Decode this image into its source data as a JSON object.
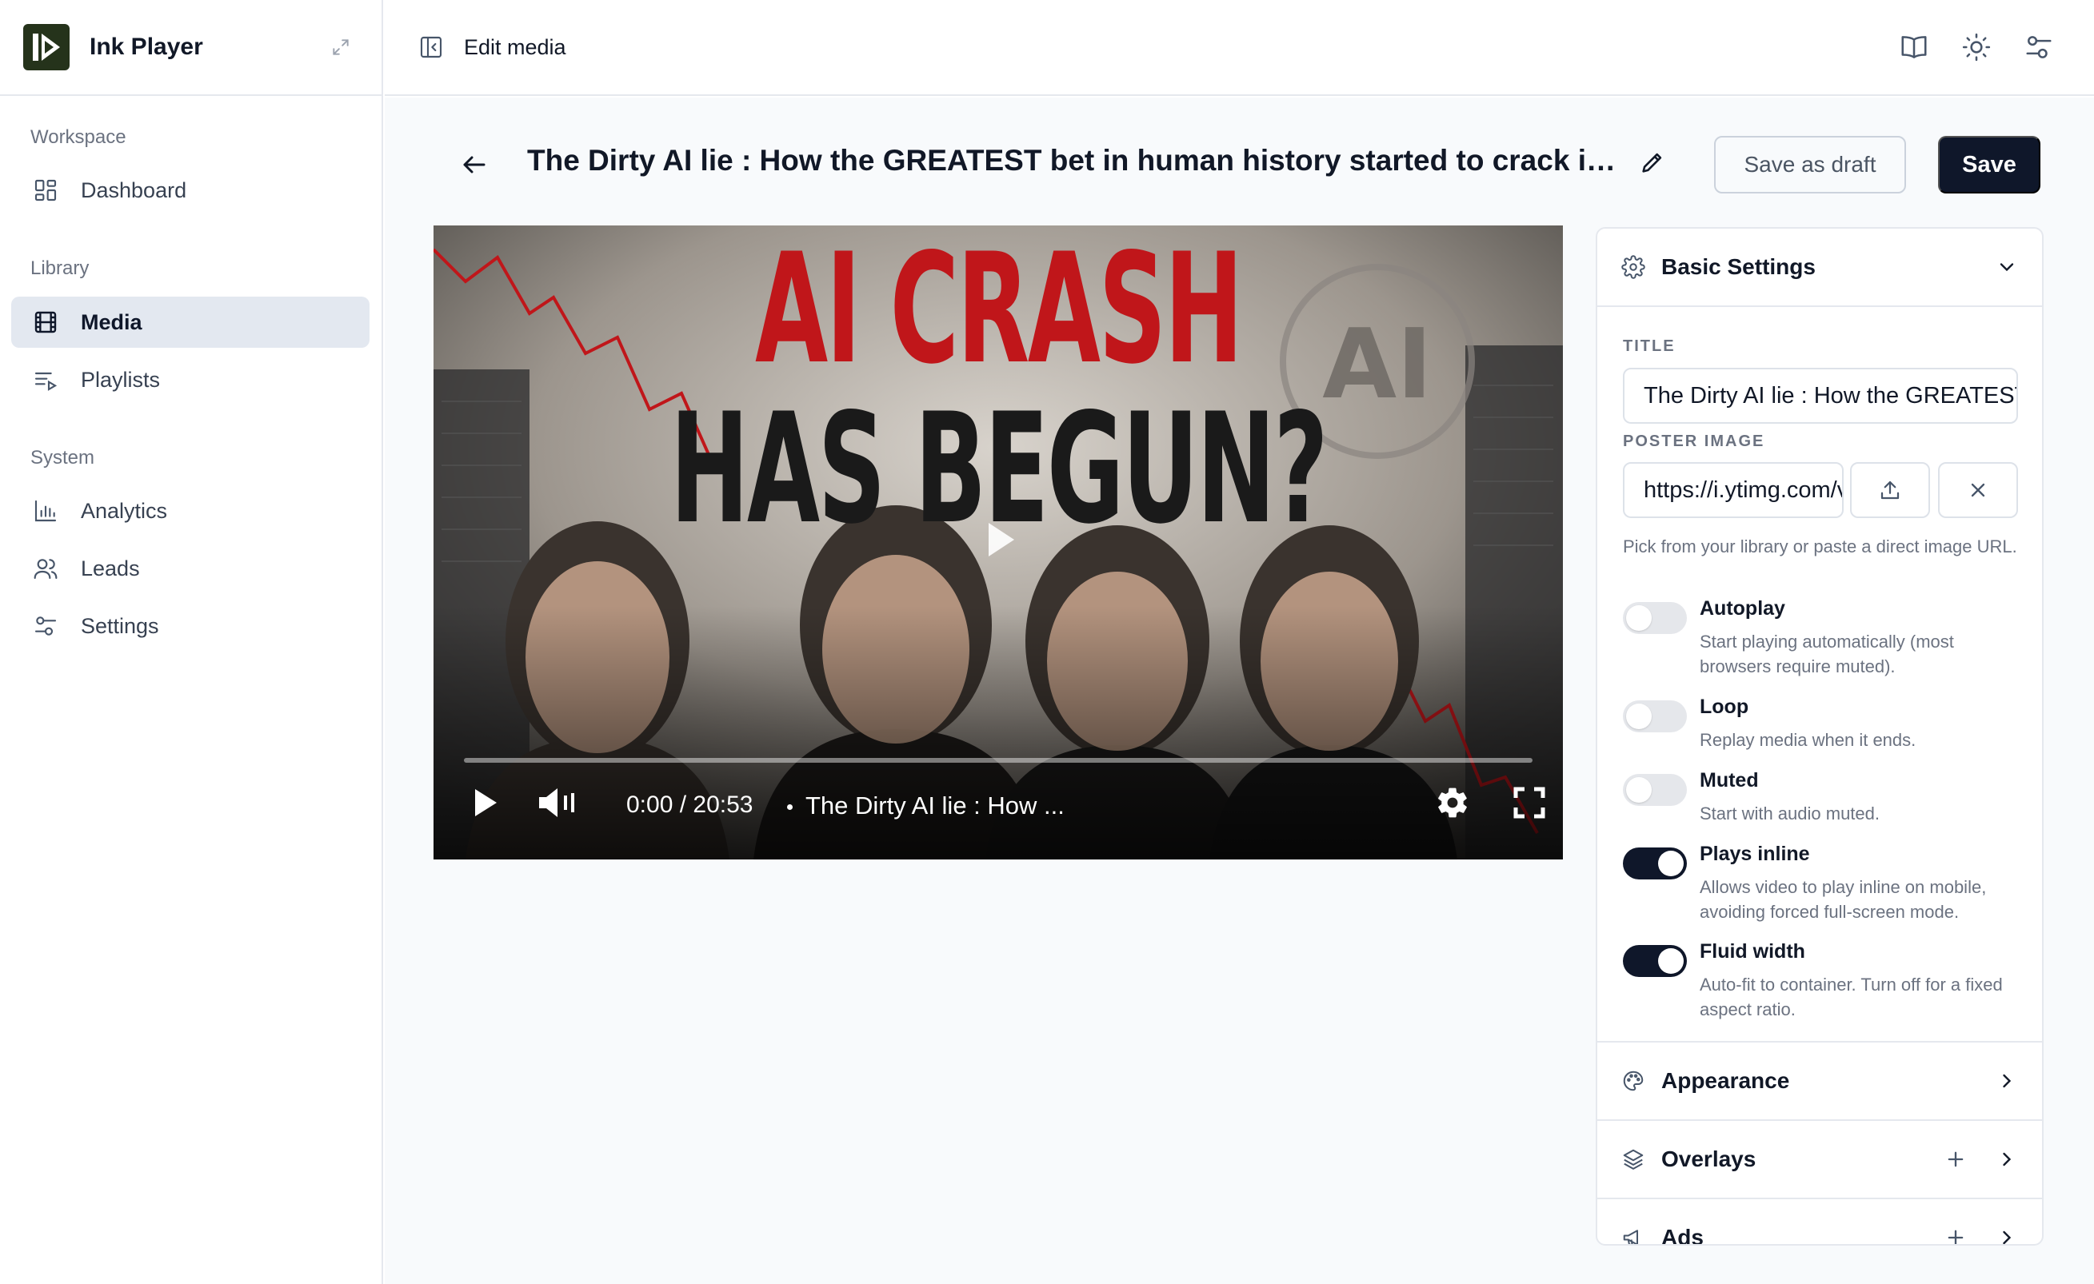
{
  "app": {
    "name": "Ink Player"
  },
  "sidebar": {
    "sections": [
      {
        "title": "Workspace",
        "items": [
          {
            "label": "Dashboard",
            "icon": "dashboard-icon"
          }
        ]
      },
      {
        "title": "Library",
        "items": [
          {
            "label": "Media",
            "icon": "film-icon",
            "active": true
          },
          {
            "label": "Playlists",
            "icon": "playlist-icon"
          }
        ]
      },
      {
        "title": "System",
        "items": [
          {
            "label": "Analytics",
            "icon": "bar-chart-icon"
          },
          {
            "label": "Leads",
            "icon": "users-icon"
          },
          {
            "label": "Settings",
            "icon": "settings-sliders-icon"
          }
        ]
      }
    ]
  },
  "header": {
    "page_title": "Edit media",
    "icons": [
      "book-icon",
      "sun-icon",
      "sliders-icon"
    ]
  },
  "editor": {
    "title": "The Dirty AI lie : How the GREATEST bet in human history started to crack in Ju...",
    "save_draft_label": "Save as draft",
    "save_label": "Save"
  },
  "player": {
    "thumbnail_headline_line1": "AI CRASH",
    "thumbnail_headline_line2": "HAS BEGUN?",
    "thumbnail_badge": "AI",
    "time": "0:00 / 20:53",
    "video_title": "The Dirty AI lie : How ...",
    "progress": 0
  },
  "panel": {
    "basic_settings": {
      "label": "Basic Settings",
      "title_label": "TITLE",
      "title_value": "The Dirty AI lie : How the GREATEST bet in human history started to crack in June",
      "poster_label": "POSTER IMAGE",
      "poster_value": "https://i.ytimg.com/vi/maxresdefault.jpg",
      "poster_hint": "Pick from your library or paste a direct image URL.",
      "toggles": [
        {
          "title": "Autoplay",
          "desc": "Start playing automatically (most browsers require muted).",
          "on": false
        },
        {
          "title": "Loop",
          "desc": "Replay media when it ends.",
          "on": false
        },
        {
          "title": "Muted",
          "desc": "Start with audio muted.",
          "on": false
        },
        {
          "title": "Plays inline",
          "desc": "Allows video to play inline on mobile, avoiding forced full-screen mode.",
          "on": true
        },
        {
          "title": "Fluid width",
          "desc": "Auto-fit to container. Turn off for a fixed aspect ratio.",
          "on": true
        }
      ]
    },
    "appearance_label": "Appearance",
    "overlays_label": "Overlays",
    "ads_label": "Ads"
  },
  "colors": {
    "primary": "#0f172a",
    "active_nav": "#e3e8f0",
    "logo_bg": "#25331b",
    "headline_red": "#c0161a"
  }
}
